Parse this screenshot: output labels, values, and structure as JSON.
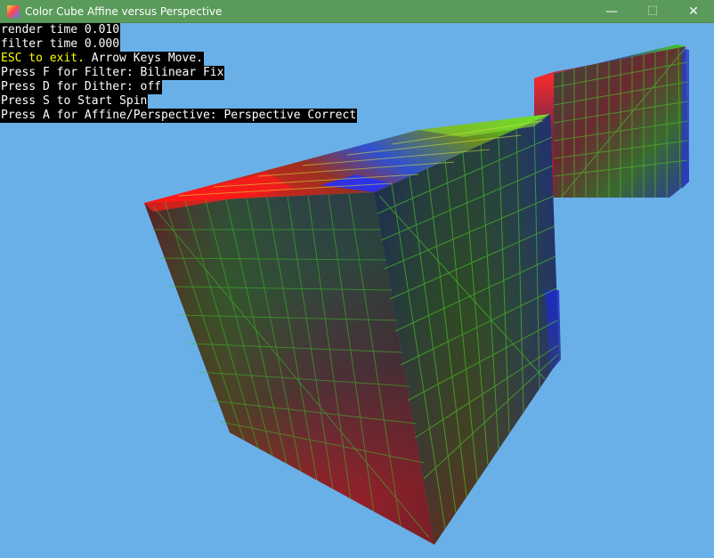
{
  "window": {
    "title": "Color Cube Affine versus Perspective",
    "controls": {
      "minimize": "—",
      "maximize": "☐",
      "close": "✕"
    }
  },
  "hud": {
    "render_time": "render time 0.010",
    "filter_time": "filter time 0.000",
    "esc_highlight": "ESC to exit.",
    "esc_rest": " Arrow Keys Move.",
    "filter_line": "Press F for Filter: Bilinear Fix",
    "dither_line": "Press D for Dither: off",
    "spin_line": "Press S to Start Spin",
    "affine_line": "Press A for Affine/Perspective: Perspective Correct"
  },
  "colors": {
    "background": "#6ab0e8",
    "titlebar": "#5a9a5a",
    "hud_bg": "#000000",
    "hud_text": "#ffffff",
    "hud_highlight": "#ffff00"
  }
}
